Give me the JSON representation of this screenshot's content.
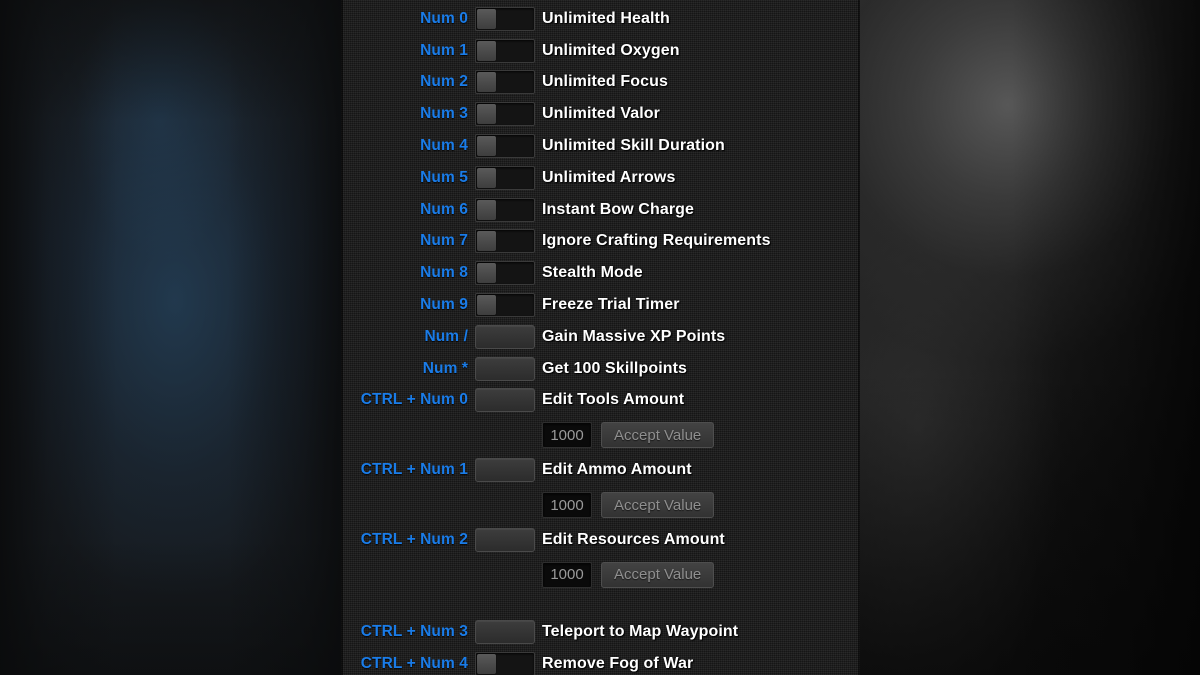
{
  "colors": {
    "hotkey_blue": "#1a7ce8",
    "label_white": "#ffffff",
    "panel_bg": "#1a1a1a",
    "toggle_track": "#141414",
    "toggle_knob": "#4a4a4a",
    "button_face": "#343434",
    "input_bg": "#0a0a0a",
    "input_text": "#9a9a9a",
    "accept_text": "#8f8f8f"
  },
  "panel": {
    "rows": [
      {
        "hotkey": "Num 0",
        "control": "toggle",
        "label": "Unlimited Health"
      },
      {
        "hotkey": "Num 1",
        "control": "toggle",
        "label": "Unlimited Oxygen"
      },
      {
        "hotkey": "Num 2",
        "control": "toggle",
        "label": "Unlimited Focus"
      },
      {
        "hotkey": "Num 3",
        "control": "toggle",
        "label": "Unlimited Valor"
      },
      {
        "hotkey": "Num 4",
        "control": "toggle",
        "label": "Unlimited Skill Duration"
      },
      {
        "hotkey": "Num 5",
        "control": "toggle",
        "label": "Unlimited Arrows"
      },
      {
        "hotkey": "Num 6",
        "control": "toggle",
        "label": "Instant Bow Charge"
      },
      {
        "hotkey": "Num 7",
        "control": "toggle",
        "label": "Ignore Crafting Requirements"
      },
      {
        "hotkey": "Num 8",
        "control": "toggle",
        "label": "Stealth Mode"
      },
      {
        "hotkey": "Num 9",
        "control": "toggle",
        "label": "Freeze Trial Timer"
      },
      {
        "hotkey": "Num /",
        "control": "button",
        "label": "Gain Massive XP Points"
      },
      {
        "hotkey": "Num *",
        "control": "button",
        "label": "Get 100 Skillpoints"
      },
      {
        "hotkey": "CTRL + Num 0",
        "control": "button",
        "label": "Edit Tools Amount"
      },
      {
        "hotkey": "CTRL + Num 1",
        "control": "button",
        "label": "Edit Ammo Amount"
      },
      {
        "hotkey": "CTRL + Num 2",
        "control": "button",
        "label": "Edit Resources Amount"
      },
      {
        "hotkey": "CTRL + Num 3",
        "control": "button",
        "label": "Teleport to Map Waypoint"
      },
      {
        "hotkey": "CTRL + Num 4",
        "control": "toggle",
        "label": "Remove Fog of War"
      }
    ],
    "editors": {
      "tools": {
        "value": "1000",
        "placeholder": "1000",
        "accept_label": "Accept Value"
      },
      "ammo": {
        "value": "1000",
        "placeholder": "1000",
        "accept_label": "Accept Value"
      },
      "resources": {
        "value": "1000",
        "placeholder": "1000",
        "accept_label": "Accept Value"
      }
    }
  }
}
